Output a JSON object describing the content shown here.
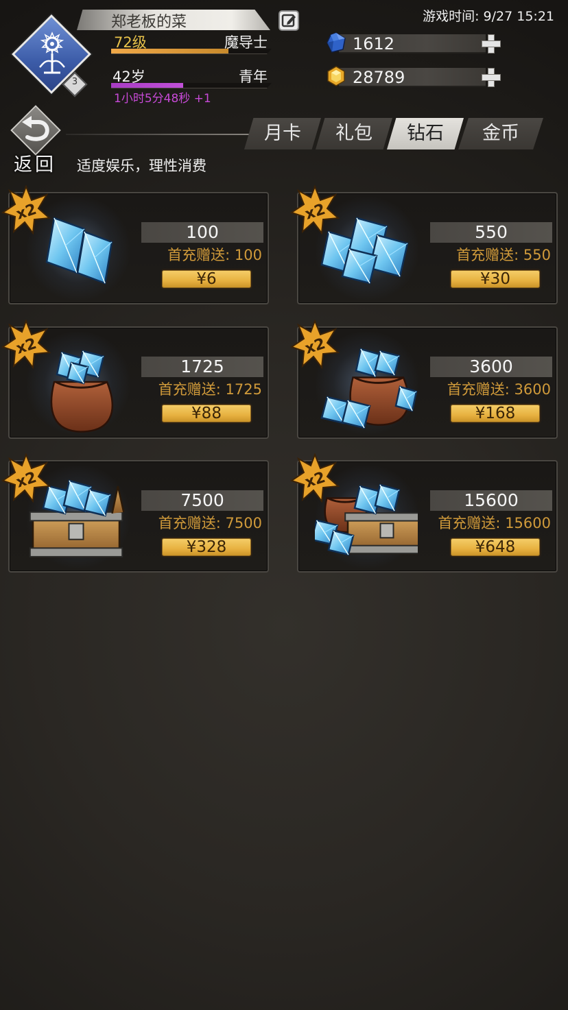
{
  "header": {
    "player_name": "郑老板的菜",
    "level": "72级",
    "class_name": "魔导士",
    "level_progress": 0.73,
    "age": "42岁",
    "age_stage": "青年",
    "age_progress": 0.45,
    "age_timer": "1小时5分48秒 +1",
    "avatar_badge": "3",
    "game_time": "游戏时间: 9/27 15:21"
  },
  "currencies": {
    "diamonds": {
      "value": "1612",
      "icon": "blue-gem-icon",
      "color": "#3a6fd8"
    },
    "gold": {
      "value": "28789",
      "icon": "gold-coin-icon",
      "color": "#f0b830"
    }
  },
  "nav": {
    "back_label": "返回",
    "tabs": [
      {
        "label": "月卡",
        "active": false
      },
      {
        "label": "礼包",
        "active": false
      },
      {
        "label": "钻石",
        "active": true
      },
      {
        "label": "金币",
        "active": false
      }
    ],
    "subtitle": "适度娱乐，理性消费"
  },
  "products": [
    {
      "amount": "100",
      "bonus": "首充赠送: 100",
      "price": "¥6",
      "badge": "x2",
      "art": "small-crystals"
    },
    {
      "amount": "550",
      "bonus": "首充赠送: 550",
      "price": "¥30",
      "badge": "x2",
      "art": "crystal-cluster"
    },
    {
      "amount": "1725",
      "bonus": "首充赠送: 1725",
      "price": "¥88",
      "badge": "x2",
      "art": "crystal-sack"
    },
    {
      "amount": "3600",
      "bonus": "首充赠送: 3600",
      "price": "¥168",
      "badge": "x2",
      "art": "crystal-sack-large"
    },
    {
      "amount": "7500",
      "bonus": "首充赠送: 7500",
      "price": "¥328",
      "badge": "x2",
      "art": "crystal-chest"
    },
    {
      "amount": "15600",
      "bonus": "首充赠送: 15600",
      "price": "¥648",
      "badge": "x2",
      "art": "crystal-chest-sack"
    }
  ],
  "colors": {
    "accent_gold": "#e7b140",
    "bonus_text": "#d09a3a",
    "level_text": "#e8c24a",
    "age_bar": "#c050d8"
  }
}
